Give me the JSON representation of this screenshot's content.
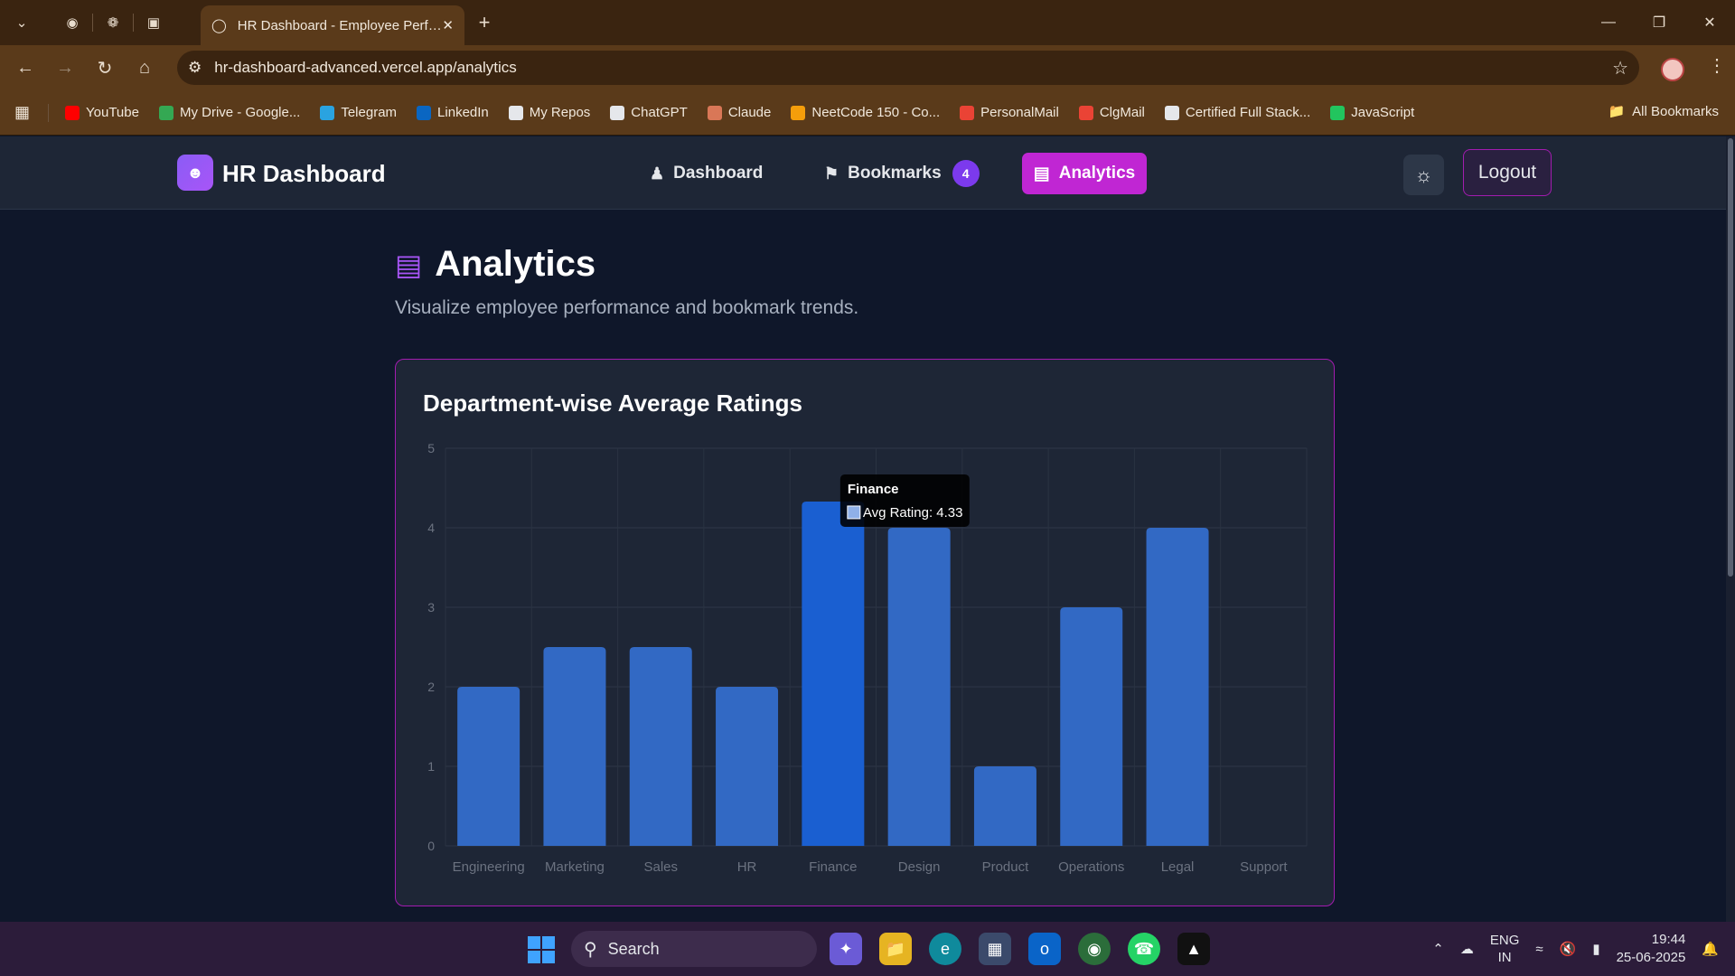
{
  "browser": {
    "tab_title": "HR Dashboard - Employee Perf…",
    "url": "hr-dashboard-advanced.vercel.app/analytics",
    "bookmarks": [
      {
        "label": "YouTube",
        "color": "#ff0000"
      },
      {
        "label": "My Drive - Google...",
        "color": "#34a853"
      },
      {
        "label": "Telegram",
        "color": "#2aa3e0"
      },
      {
        "label": "LinkedIn",
        "color": "#0a66c2"
      },
      {
        "label": "My Repos",
        "color": "#e5e7eb"
      },
      {
        "label": "ChatGPT",
        "color": "#e5e7eb"
      },
      {
        "label": "Claude",
        "color": "#d97757"
      },
      {
        "label": "NeetCode 150 - Co...",
        "color": "#f59e0b"
      },
      {
        "label": "PersonalMail",
        "color": "#ea4335"
      },
      {
        "label": "ClgMail",
        "color": "#ea4335"
      },
      {
        "label": "Certified Full Stack...",
        "color": "#e5e7eb"
      },
      {
        "label": "JavaScript",
        "color": "#22c55e"
      }
    ],
    "all_bookmarks": "All Bookmarks"
  },
  "app": {
    "brand": "HR Dashboard",
    "nav": {
      "dashboard": "Dashboard",
      "bookmarks": "Bookmarks",
      "bookmarks_count": "4",
      "analytics": "Analytics"
    },
    "logout": "Logout"
  },
  "page": {
    "title": "Analytics",
    "subtitle": "Visualize employee performance and bookmark trends."
  },
  "chart_card": {
    "title": "Department-wise Average Ratings"
  },
  "chart_data": {
    "type": "bar",
    "title": "Department-wise Average Ratings",
    "categories": [
      "Engineering",
      "Marketing",
      "Sales",
      "HR",
      "Finance",
      "Design",
      "Product",
      "Operations",
      "Legal",
      "Support"
    ],
    "series": [
      {
        "name": "Avg Rating",
        "values": [
          2,
          2.5,
          2.5,
          2,
          4.33,
          4,
          1,
          3,
          4,
          0
        ]
      }
    ],
    "ylim": [
      0,
      5
    ],
    "yticks": [
      "0",
      "1",
      "2",
      "3",
      "4",
      "5"
    ],
    "grid": true,
    "bar_color": "#3269c4",
    "highlight_color": "#1a5fd1",
    "tooltip": {
      "category": "Finance",
      "label": "Avg Rating: 4.33",
      "index": 4
    }
  },
  "taskbar": {
    "search": "Search",
    "lang": "ENG",
    "region": "IN",
    "time": "19:44",
    "date": "25-06-2025"
  }
}
